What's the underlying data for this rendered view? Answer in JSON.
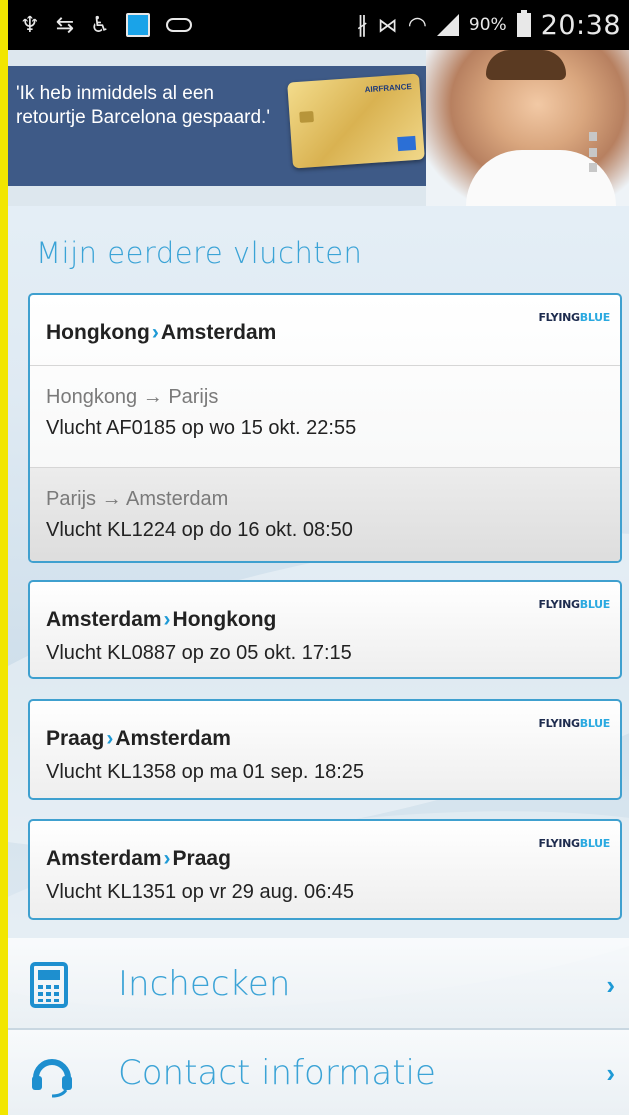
{
  "statusbar": {
    "icons": [
      "usb-icon",
      "sync-icon",
      "accessibility-icon",
      "screen-mirror-icon",
      "voicemail-icon",
      "bluetooth-icon",
      "mute-icon",
      "wifi-icon",
      "signal-icon",
      "battery-charging-icon"
    ],
    "usb_glyph": "♆",
    "sync_glyph": "⇆",
    "accessibility_glyph": "♿",
    "bluetooth_glyph": "∦",
    "mute_glyph": "⋈",
    "wifi_glyph": "◠",
    "battery_percent": "90%",
    "time": "20:38"
  },
  "banner": {
    "quote": "'Ik heb inmiddels al een retourtje Barcelona gespaard.'",
    "card_brand": "AIRFRANCE",
    "colors": {
      "panel": "#3e5a87",
      "card_gold": "#d9b251"
    }
  },
  "section": {
    "title": "Mijn eerdere vluchten"
  },
  "brand_logo": {
    "part1": "FLYING",
    "part2": "BLUE"
  },
  "flights": [
    {
      "from": "Hongkong",
      "to": "Amsterdam",
      "legs": [
        {
          "from": "Hongkong",
          "arrow": "→",
          "to": "Parijs",
          "flight_text": "Vlucht AF0185 op wo 15 okt. 22:55"
        },
        {
          "from": "Parijs",
          "arrow": "→",
          "to": "Amsterdam",
          "flight_text": "Vlucht KL1224 op do 16 okt. 08:50"
        }
      ]
    },
    {
      "from": "Amsterdam",
      "to": "Hongkong",
      "flight_text": "Vlucht KL0887 op zo 05 okt. 17:15"
    },
    {
      "from": "Praag",
      "to": "Amsterdam",
      "flight_text": "Vlucht KL1358 op ma 01 sep. 18:25"
    },
    {
      "from": "Amsterdam",
      "to": "Praag",
      "flight_text": "Vlucht KL1351 op vr 29 aug. 06:45"
    }
  ],
  "route_chevron": "›",
  "menu": {
    "checkin": {
      "label": "Inchecken",
      "icon": "calculator-phone-icon"
    },
    "contact": {
      "label": "Contact informatie",
      "icon": "headset-icon"
    },
    "chevron": "›"
  },
  "colors": {
    "accent": "#3aa3d6",
    "card_border": "#3fa0cf",
    "frame": "#f2e600"
  }
}
